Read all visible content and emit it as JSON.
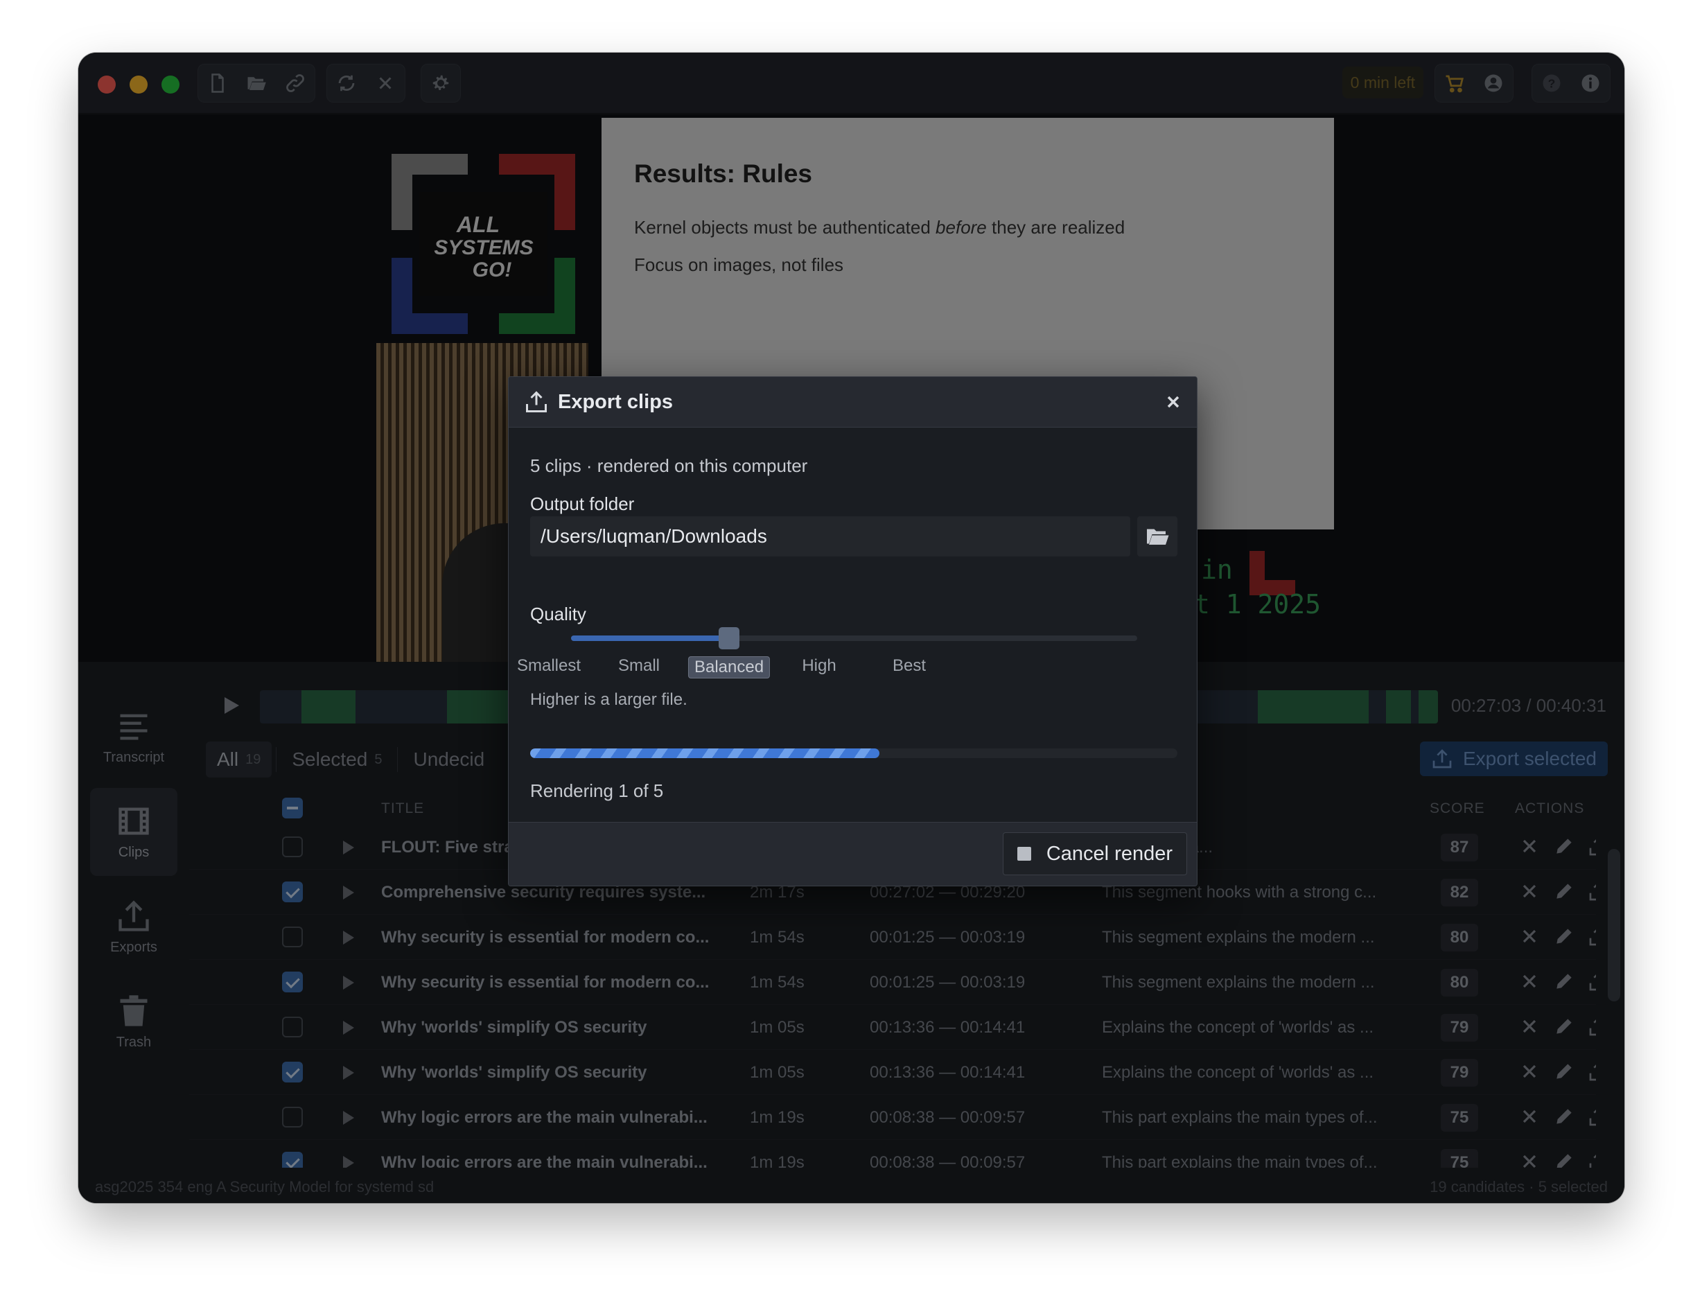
{
  "toolbar": {
    "time_left": "0 min left",
    "icons": [
      "new-file-icon",
      "open-folder-icon",
      "link-icon",
      "refresh-icon",
      "close-icon",
      "gear-icon",
      "cart-icon",
      "account-icon",
      "help-icon",
      "info-icon"
    ]
  },
  "video": {
    "slide_title": "Results: Rules",
    "slide_line1_pre": "Kernel objects must be authenticated ",
    "slide_line1_em": "before",
    "slide_line1_post": " they are realized",
    "slide_line2": "Focus on images, not files",
    "logo_text": [
      "ALL",
      "SYSTEMS",
      "GO!"
    ],
    "overlay_text1": "in",
    "overlay_text2": "t 1 2025"
  },
  "player": {
    "timecode": "00:27:03 / 00:40:31"
  },
  "sidebar": {
    "items": [
      {
        "label": "Transcript",
        "icon": "transcript-icon"
      },
      {
        "label": "Clips",
        "icon": "film-icon"
      },
      {
        "label": "Exports",
        "icon": "upload-icon"
      },
      {
        "label": "Trash",
        "icon": "trash-icon"
      }
    ]
  },
  "tabs": {
    "all_label": "All",
    "all_count": "19",
    "selected_label": "Selected",
    "selected_count": "5",
    "undecided_label": "Undecid"
  },
  "export_selected_label": "Export selected",
  "table": {
    "headers": {
      "title": "TITLE",
      "score": "SCORE",
      "actions": "ACTIONS"
    },
    "rows": [
      {
        "checked": false,
        "title": "FLOUT: Five strategies to",
        "duration": "",
        "range": "",
        "desc": "es a memora...",
        "score": "87"
      },
      {
        "checked": true,
        "title": "Comprehensive security requires syste...",
        "duration": "2m 17s",
        "range": "00:27:02 — 00:29:20",
        "desc": "This segment hooks with a strong c...",
        "score": "82"
      },
      {
        "checked": false,
        "title": "Why security is essential for modern co...",
        "duration": "1m 54s",
        "range": "00:01:25 — 00:03:19",
        "desc": "This segment explains the modern ...",
        "score": "80"
      },
      {
        "checked": true,
        "title": "Why security is essential for modern co...",
        "duration": "1m 54s",
        "range": "00:01:25 — 00:03:19",
        "desc": "This segment explains the modern ...",
        "score": "80"
      },
      {
        "checked": false,
        "title": "Why 'worlds' simplify OS security",
        "duration": "1m 05s",
        "range": "00:13:36 — 00:14:41",
        "desc": "Explains the concept of 'worlds' as ...",
        "score": "79"
      },
      {
        "checked": true,
        "title": "Why 'worlds' simplify OS security",
        "duration": "1m 05s",
        "range": "00:13:36 — 00:14:41",
        "desc": "Explains the concept of 'worlds' as ...",
        "score": "79"
      },
      {
        "checked": false,
        "title": "Why logic errors are the main vulnerabi...",
        "duration": "1m 19s",
        "range": "00:08:38 — 00:09:57",
        "desc": "This part explains the main types of...",
        "score": "75"
      },
      {
        "checked": true,
        "title": "Why logic errors are the main vulnerabi...",
        "duration": "1m 19s",
        "range": "00:08:38 — 00:09:57",
        "desc": "This part explains the main types of...",
        "score": "75"
      }
    ]
  },
  "status": {
    "left": "asg2025 354 eng A Security Model for systemd sd",
    "right": "19 candidates · 5 selected"
  },
  "dialog": {
    "title": "Export clips",
    "subtitle": "5 clips · rendered on this computer",
    "output_label": "Output folder",
    "output_path": "/Users/luqman/Downloads",
    "quality_label": "Quality",
    "quality_options": [
      "Smallest",
      "Small",
      "Balanced",
      "High",
      "Best"
    ],
    "quality_selected_index": 2,
    "hint": "Higher is a larger file.",
    "progress_fraction": 0.54,
    "render_status": "Rendering 1 of 5",
    "cancel_label": "Cancel render"
  }
}
